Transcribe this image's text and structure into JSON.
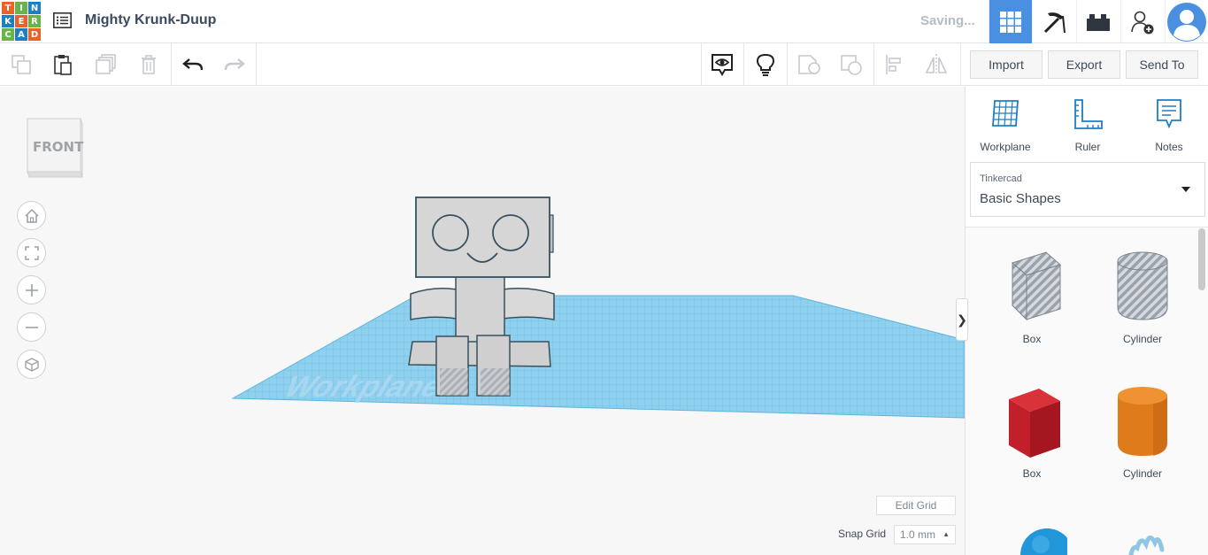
{
  "app": {
    "logo_letters": [
      "T",
      "I",
      "N",
      "K",
      "E",
      "R",
      "C",
      "A",
      "D"
    ],
    "design_title": "Mighty Krunk-Duup",
    "status": "Saving..."
  },
  "nav": {
    "items": [
      {
        "name": "3d-design-grid",
        "icon": "grid-icon",
        "active": true
      },
      {
        "name": "minecraft",
        "icon": "pickaxe-icon",
        "active": false
      },
      {
        "name": "lego",
        "icon": "brick-icon",
        "active": false
      },
      {
        "name": "invite",
        "icon": "add-user-icon",
        "active": false
      },
      {
        "name": "profile",
        "icon": "avatar-icon",
        "active": false
      }
    ]
  },
  "toolbar": {
    "icons": [
      "copy-icon",
      "paste-icon",
      "duplicate-icon",
      "delete-icon",
      "undo-icon",
      "redo-icon",
      "notes-visibility-icon",
      "lightbulb-icon",
      "group-icon",
      "ungroup-icon",
      "align-icon",
      "mirror-icon"
    ],
    "import_label": "Import",
    "export_label": "Export",
    "send_to_label": "Send To"
  },
  "viewport": {
    "viewcube_face": "FRONT",
    "workplane_text": "Workplane",
    "edit_grid_label": "Edit Grid",
    "snap_grid_label": "Snap Grid",
    "snap_grid_value": "1.0 mm",
    "collapse_glyph": "❯"
  },
  "panel": {
    "tools": [
      {
        "label": "Workplane",
        "icon": "workplane-icon"
      },
      {
        "label": "Ruler",
        "icon": "ruler-icon"
      },
      {
        "label": "Notes",
        "icon": "notes-icon"
      }
    ],
    "library_provider": "Tinkercad",
    "library_name": "Basic Shapes",
    "shapes": [
      {
        "label": "Box",
        "kind": "box-hole"
      },
      {
        "label": "Cylinder",
        "kind": "cylinder-hole"
      },
      {
        "label": "Box",
        "kind": "box-solid"
      },
      {
        "label": "Cylinder",
        "kind": "cylinder-solid"
      }
    ]
  },
  "colors": {
    "accent": "#4a8fe0",
    "logo_orange": "#e8632b",
    "logo_green": "#6ab24a",
    "logo_blue": "#1e7ec2",
    "workplane_blue": "#7cc8ec",
    "box_red": "#c8202a",
    "cylinder_orange": "#e07b1c",
    "sphere_blue": "#2196d8"
  }
}
